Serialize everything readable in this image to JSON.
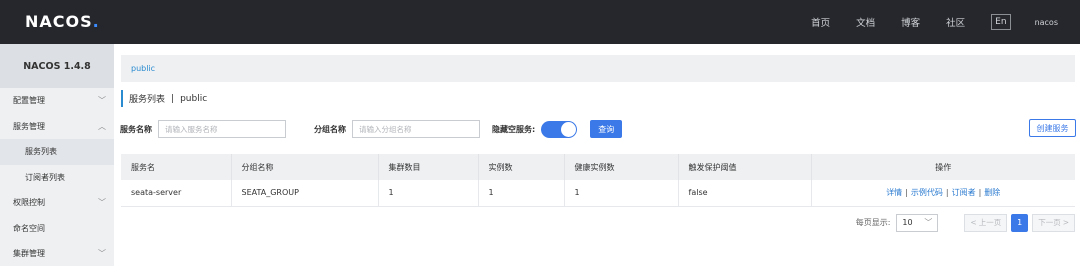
{
  "header": {
    "logo": "NACOS",
    "logo_dot": ".",
    "nav": [
      "首页",
      "文档",
      "博客",
      "社区"
    ],
    "lang": "En",
    "user": "nacos"
  },
  "sidebar": {
    "title": "NACOS 1.4.8",
    "items": [
      {
        "label": "配置管理",
        "chevron": "chevron-down-icon"
      },
      {
        "label": "服务管理",
        "chevron": "chevron-up-icon"
      },
      {
        "label": "服务列表"
      },
      {
        "label": "订阅者列表"
      },
      {
        "label": "权限控制",
        "chevron": "chevron-down-icon"
      },
      {
        "label": "命名空间"
      },
      {
        "label": "集群管理",
        "chevron": "chevron-down-icon"
      }
    ]
  },
  "breadcrumb": "public",
  "page": {
    "title": "服务列表",
    "separator": "|",
    "namespace": "public"
  },
  "filter": {
    "service_label": "服务名称",
    "service_placeholder": "请输入服务名称",
    "group_label": "分组名称",
    "group_placeholder": "请输入分组名称",
    "hide_empty_label": "隐藏空服务:",
    "hide_empty_on": true,
    "query_button": "查询",
    "create_button": "创建服务"
  },
  "table": {
    "columns": [
      "服务名",
      "分组名称",
      "集群数目",
      "实例数",
      "健康实例数",
      "触发保护阈值",
      "操作"
    ],
    "rows": [
      {
        "service": "seata-server",
        "group": "SEATA_GROUP",
        "clusters": "1",
        "instances": "1",
        "healthy": "1",
        "threshold": "false",
        "ops": [
          "详情",
          "示例代码",
          "订阅者",
          "删除"
        ]
      }
    ]
  },
  "pager": {
    "label": "每页显示:",
    "page_size": "10",
    "prev": "上一页",
    "current": "1",
    "next": "下一页"
  },
  "colors": {
    "accent": "#3b79e8",
    "link": "#2a8bd1",
    "topbar": "#25272c"
  }
}
